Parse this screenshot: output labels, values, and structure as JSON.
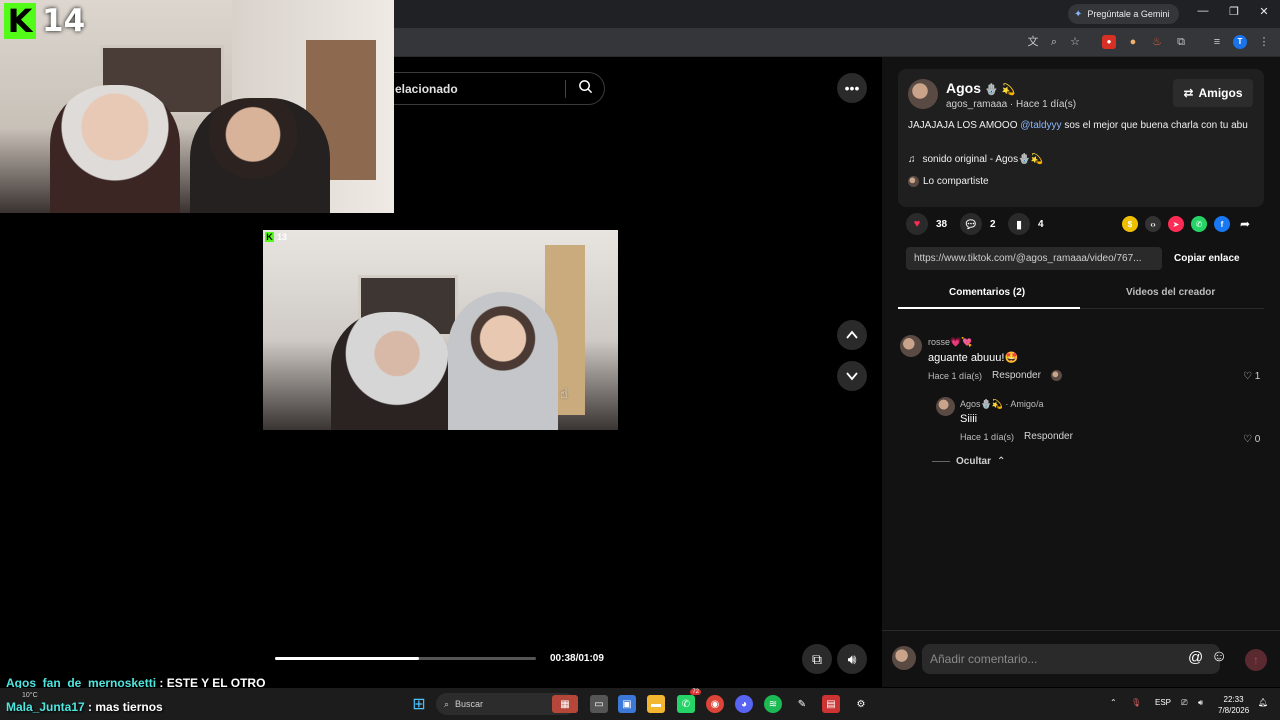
{
  "browser": {
    "gemini_label": "Pregúntale a Gemini",
    "profile_initial": "T"
  },
  "stream": {
    "viewer_count": "14",
    "video_viewer_count": "13"
  },
  "search": {
    "text": "elacionado"
  },
  "video": {
    "time": "00:38/01:09",
    "progress": 0.55
  },
  "post": {
    "author": "Agos",
    "author_emojis": "🪬 💫",
    "handle_time": "agos_ramaaa · Hace 1 día(s)",
    "follow_label": "Amigos",
    "desc_before": "JAJAJAJA LOS AMOOO ",
    "mention": "@taldyyy",
    "desc_after": " sos el mejor que buena charla con tu abu",
    "sound": "sonido original - Agos🪬💫",
    "shared": "Lo compartiste",
    "likes": "38",
    "comments": "2",
    "saves": "4",
    "link": "https://www.tiktok.com/@agos_ramaaa/video/767...",
    "copy_label": "Copiar enlace"
  },
  "tabs": {
    "comments": "Comentarios (2)",
    "creator_videos": "Videos del creador"
  },
  "comments": [
    {
      "user": "rosse💗💘",
      "text": "aguante abuuu!🤩",
      "time": "Hace 1 día(s)",
      "reply": "Responder",
      "likes": "1"
    },
    {
      "user": "Agos🪬💫 · Amigo/a",
      "text": "Siiii",
      "time": "Hace 1 día(s)",
      "reply": "Responder",
      "likes": "0"
    }
  ],
  "hide_label": "Ocultar",
  "add_comment_placeholder": "Añadir comentario...",
  "chat": [
    {
      "user": "Agos_fan_de_mernosketti",
      "msg": " : ESTE Y EL OTRO"
    },
    {
      "user": "Mala_Junta17",
      "msg": " : mas tiernos"
    }
  ],
  "taskbar": {
    "search": "Buscar",
    "weather": "10°C",
    "lang": "ESP",
    "time": "22:33",
    "date": "7/8/2026",
    "whatsapp_badge": "72"
  }
}
